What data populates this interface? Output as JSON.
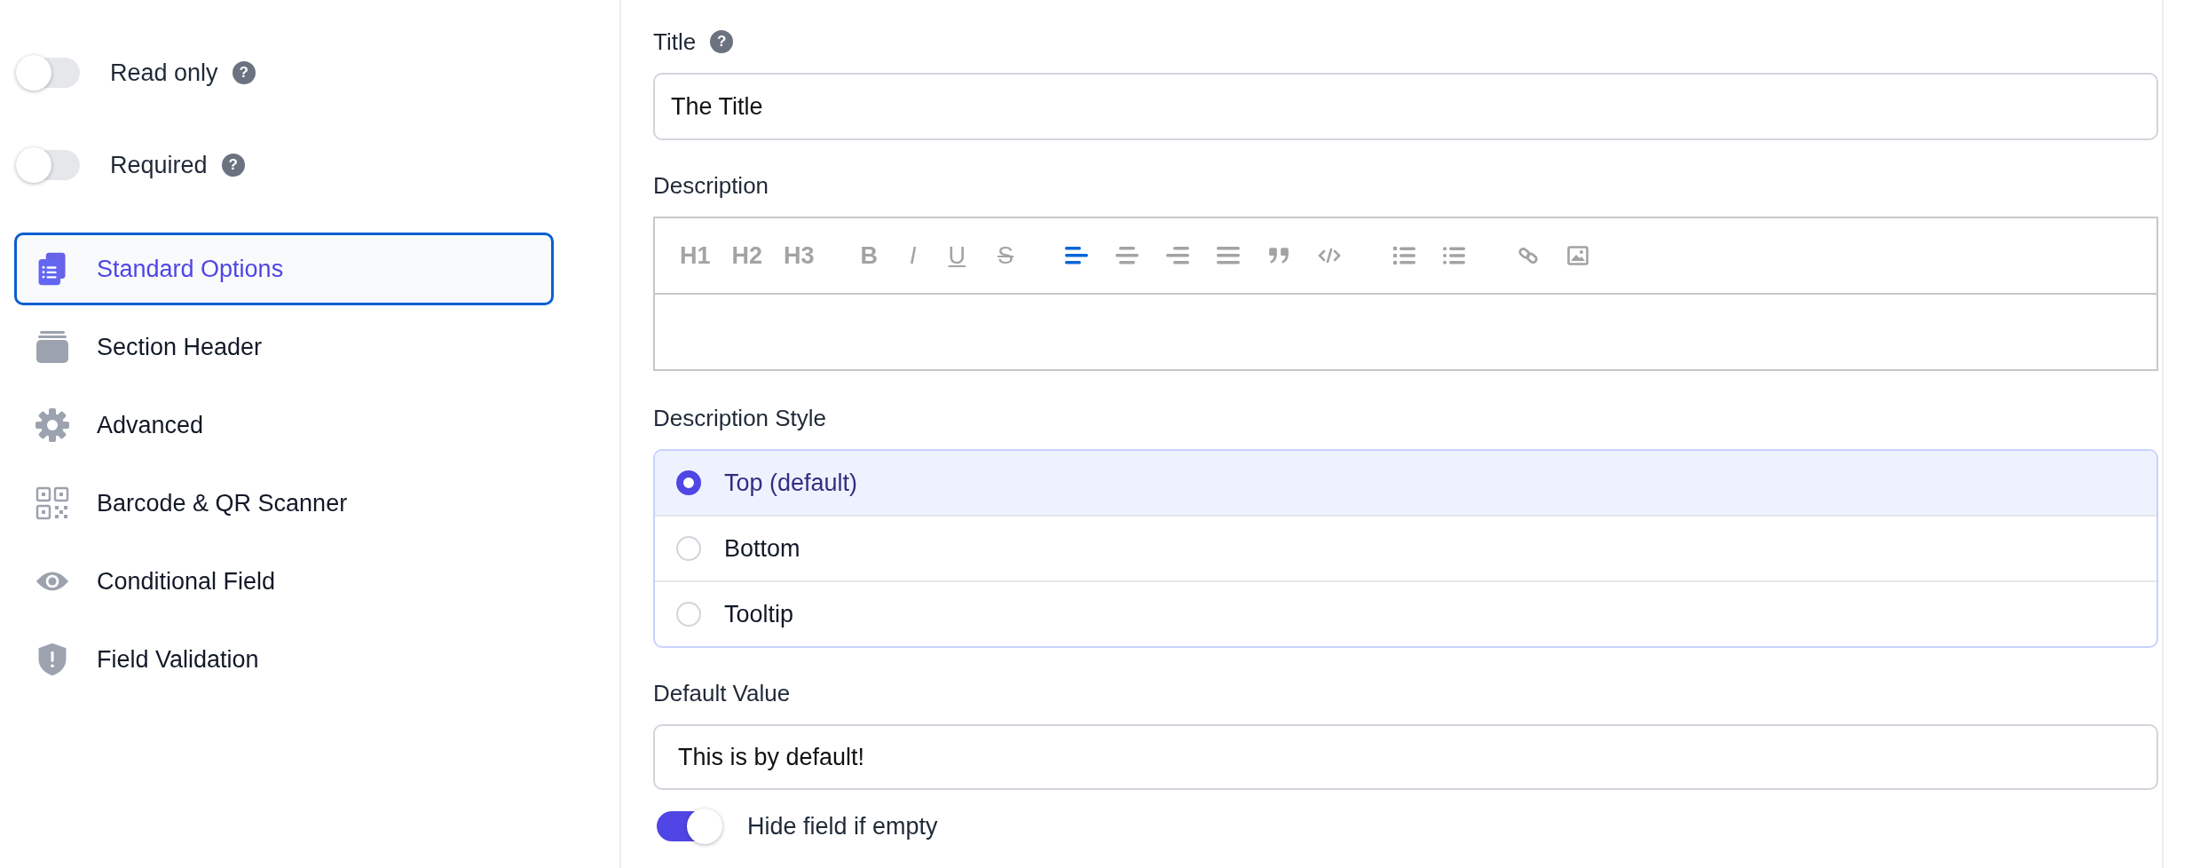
{
  "sidebar": {
    "toggles": [
      {
        "label": "Read only",
        "on": false,
        "help": "?"
      },
      {
        "label": "Required",
        "on": false,
        "help": "?"
      }
    ],
    "items": [
      {
        "label": "Standard Options",
        "kind": "clipboard",
        "selected": true
      },
      {
        "label": "Section Header",
        "kind": "stack",
        "selected": false
      },
      {
        "label": "Advanced",
        "kind": "gear",
        "selected": false
      },
      {
        "label": "Barcode & QR Scanner",
        "kind": "qr",
        "selected": false
      },
      {
        "label": "Conditional Field",
        "kind": "eye",
        "selected": false
      },
      {
        "label": "Field Validation",
        "kind": "shield",
        "selected": false
      }
    ]
  },
  "title_field": {
    "label": "Title",
    "help": "?",
    "value": "The Title"
  },
  "description": {
    "label": "Description",
    "toolbar": [
      [
        {
          "kind": "heading",
          "label": "H1"
        },
        {
          "kind": "heading",
          "label": "H2"
        },
        {
          "kind": "heading",
          "label": "H3"
        }
      ],
      [
        {
          "kind": "bold",
          "label": "B"
        },
        {
          "kind": "italic",
          "label": "I"
        },
        {
          "kind": "underline",
          "label": "U"
        },
        {
          "kind": "strike",
          "label": "S"
        }
      ],
      [
        {
          "kind": "align-left",
          "selected": true
        },
        {
          "kind": "align-center",
          "selected": false
        },
        {
          "kind": "align-right",
          "selected": false
        },
        {
          "kind": "justify",
          "selected": false
        },
        {
          "kind": "quote"
        },
        {
          "kind": "code"
        }
      ],
      [
        {
          "kind": "ordered-list"
        },
        {
          "kind": "bullet-list"
        }
      ],
      [
        {
          "kind": "link"
        },
        {
          "kind": "image"
        }
      ]
    ]
  },
  "description_style": {
    "label": "Description Style",
    "options": [
      {
        "label": "Top (default)",
        "selected": true
      },
      {
        "label": "Bottom",
        "selected": false
      },
      {
        "label": "Tooltip",
        "selected": false
      }
    ]
  },
  "default_value": {
    "label": "Default Value",
    "value": "This is by default!"
  },
  "hide_if_empty": {
    "label": "Hide field if empty",
    "on": true
  }
}
